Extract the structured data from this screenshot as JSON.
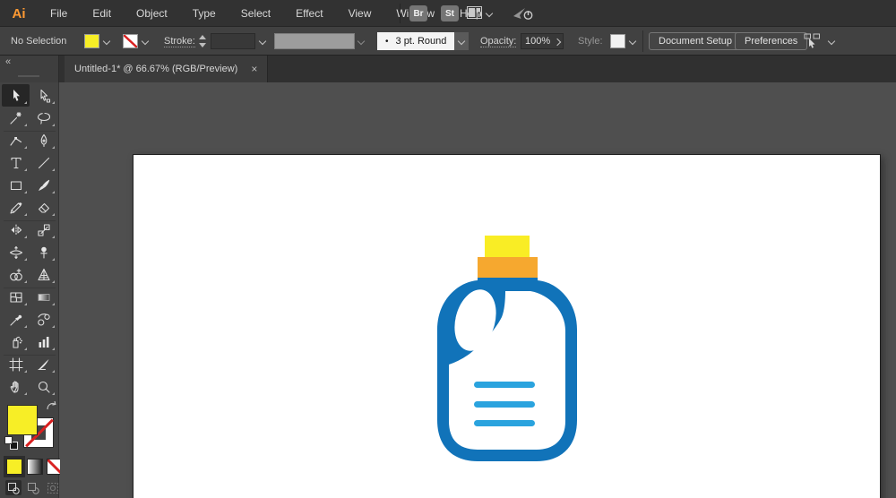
{
  "menubar": {
    "logo_label": "Ai",
    "items": [
      "File",
      "Edit",
      "Object",
      "Type",
      "Select",
      "Effect",
      "View",
      "Window",
      "Help"
    ],
    "bridge_badge": "Br",
    "stock_badge": "St"
  },
  "controlbar": {
    "selection_status": "No Selection",
    "fill_color": "#f7ee26",
    "stroke_label": "Stroke:",
    "brush_mark": "•",
    "brush_definition": "3 pt. Round",
    "opacity_label": "Opacity:",
    "opacity_value": "100%",
    "style_label": "Style:",
    "document_setup_label": "Document Setup",
    "preferences_label": "Preferences"
  },
  "tabbar": {
    "collapse_glyph": "«",
    "document_tab": {
      "title": "Untitled-1* @ 66.67% (RGB/Preview)",
      "close_glyph": "×",
      "active": true
    }
  },
  "toolbar": {
    "fill_color": "#f7ee26",
    "selected_tool": "selection",
    "tools": [
      "selection",
      "direct-selection",
      "magic-wand",
      "lasso",
      "curvature",
      "pen",
      "type",
      "line-segment",
      "rectangle",
      "paintbrush",
      "pencil",
      "eraser",
      "reflect",
      "scale",
      "width",
      "puppet-warp",
      "shape-builder",
      "perspective-grid",
      "mesh",
      "gradient",
      "eyedropper",
      "blend",
      "symbol-sprayer",
      "column-graph",
      "artboard",
      "slice",
      "hand",
      "zoom"
    ],
    "drawing_modes": [
      "draw-normal",
      "draw-behind",
      "draw-inside"
    ],
    "active_drawing_mode": "draw-normal"
  },
  "artwork": {
    "type": "detergent-bottle-flat-icon",
    "cap_top_color": "#f9ed25",
    "cap_base_color": "#f6a82f",
    "body_color": "#1173b9",
    "interior_color": "#ffffff",
    "label_line_color": "#2aa3de",
    "label_line_count": 3
  },
  "colors": {
    "menubar_bg": "#323232",
    "controlbar_bg": "#414141",
    "tabbar_bg": "#303030",
    "tab_bg": "#3b3b3b",
    "panel_bg": "#434343",
    "canvas_bg": "#4f4f4f",
    "artboard_bg": "#ffffff",
    "selected_tool_bg": "#262626",
    "accent_red": "#d92121"
  }
}
